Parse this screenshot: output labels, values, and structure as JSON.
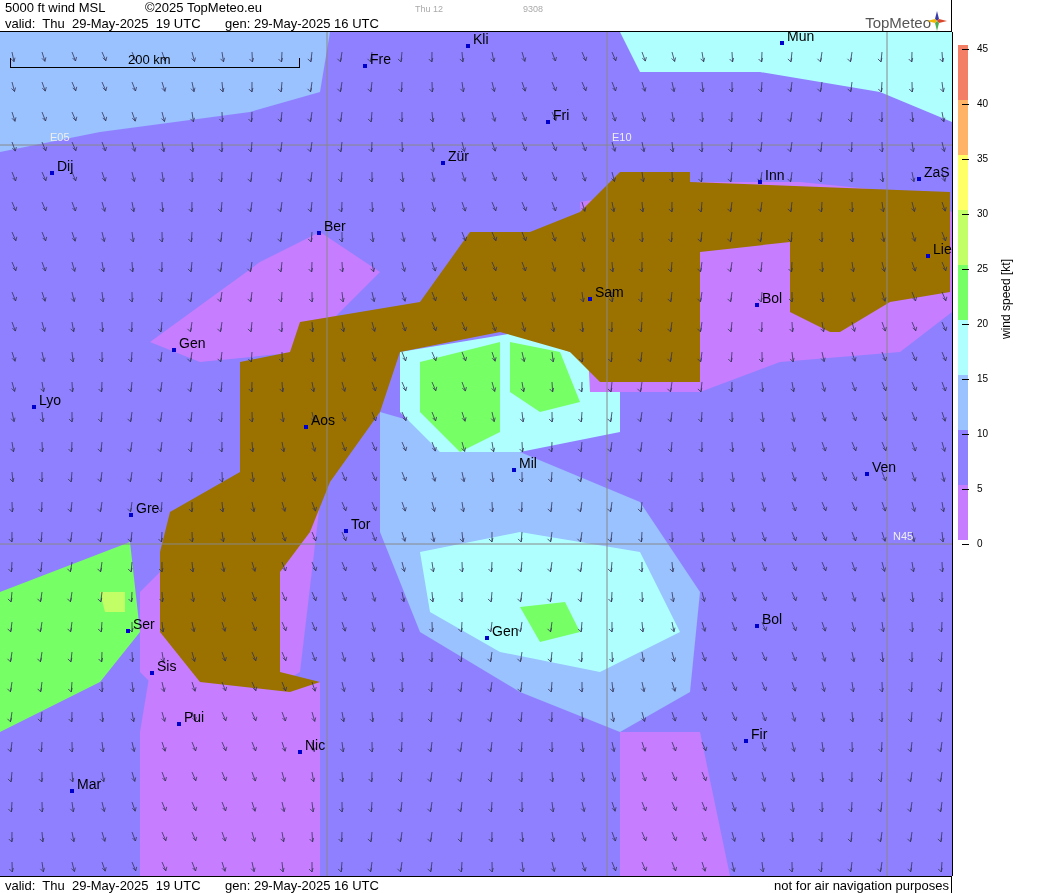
{
  "header": {
    "title": "5000 ft wind MSL",
    "copyright": "©2025 TopMeteo.eu",
    "step": "Thu 12",
    "code": "9308",
    "valid": "valid:  Thu  29-May-2025  19 UTC",
    "generated": "gen: 29-May-2025 16 UTC",
    "logo": "TopMeteo"
  },
  "map": {
    "scale_label": "200 km",
    "grid_labels": [
      "E05",
      "E10",
      "N45"
    ],
    "cities": [
      "Kli",
      "Mun",
      "Fre",
      "Fri",
      "Dij",
      "Zür",
      "Inn",
      "ZaS",
      "Ber",
      "Lie",
      "Sam",
      "Bol",
      "Gen",
      "Lyo",
      "Aos",
      "Mil",
      "Ven",
      "Gre",
      "Tor",
      "Ser",
      "Gen",
      "Bol",
      "Sis",
      "Pui",
      "Nic",
      "Fir",
      "Mar"
    ]
  },
  "legend": {
    "title": "wind speed [kt]",
    "ticks": [
      "45",
      "40",
      "35",
      "30",
      "25",
      "20",
      "15",
      "10",
      "5",
      "0"
    ],
    "bands": [
      {
        "color": "#f27f66"
      },
      {
        "color": "#ffb366"
      },
      {
        "color": "#ffff66"
      },
      {
        "color": "#c2ff66"
      },
      {
        "color": "#77ff66"
      },
      {
        "color": "#b0ffff"
      },
      {
        "color": "#99c2ff"
      },
      {
        "color": "#8f80ff"
      },
      {
        "color": "#c77dff"
      }
    ]
  },
  "footer": {
    "valid": "valid:  Thu  29-May-2025  19 UTC",
    "generated": "gen: 29-May-2025 16 UTC",
    "notice": "not for air navigation purposes"
  }
}
